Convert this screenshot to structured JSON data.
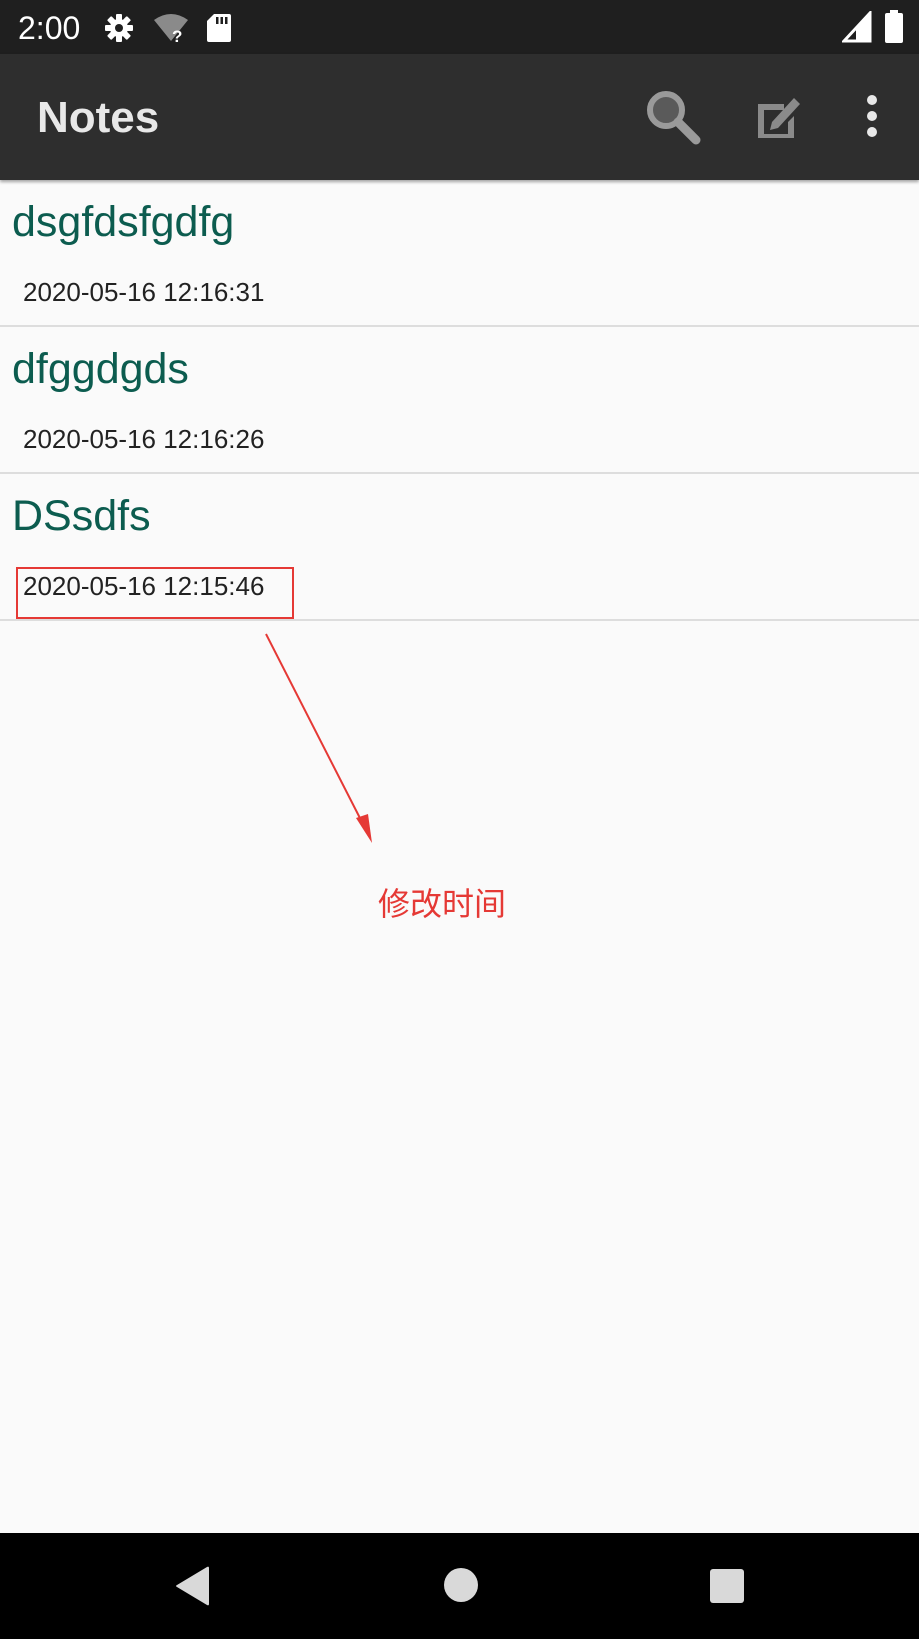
{
  "status_bar": {
    "time": "2:00",
    "icons": [
      "gear-icon",
      "wifi-unknown-icon",
      "sd-card-icon",
      "cell-signal-icon",
      "battery-icon"
    ]
  },
  "app_bar": {
    "title": "Notes",
    "actions": [
      "search-icon",
      "compose-note-icon",
      "more-options-icon"
    ]
  },
  "notes": [
    {
      "title": "dsgfdsfgdfg",
      "date": "2020-05-16 12:16:31"
    },
    {
      "title": "dfggdgds",
      "date": "2020-05-16 12:16:26"
    },
    {
      "title": "DSsdfs",
      "date": "2020-05-16 12:15:46"
    }
  ],
  "annotation": {
    "label": "修改时间",
    "color": "#e53935"
  },
  "nav_bar": {
    "buttons": [
      "back-icon",
      "home-icon",
      "recents-icon"
    ]
  },
  "colors": {
    "status_bar_bg": "#1f1f1f",
    "app_bar_bg": "#2e2e2e",
    "note_title": "#0c5c4f",
    "list_bg": "#fafafa"
  }
}
